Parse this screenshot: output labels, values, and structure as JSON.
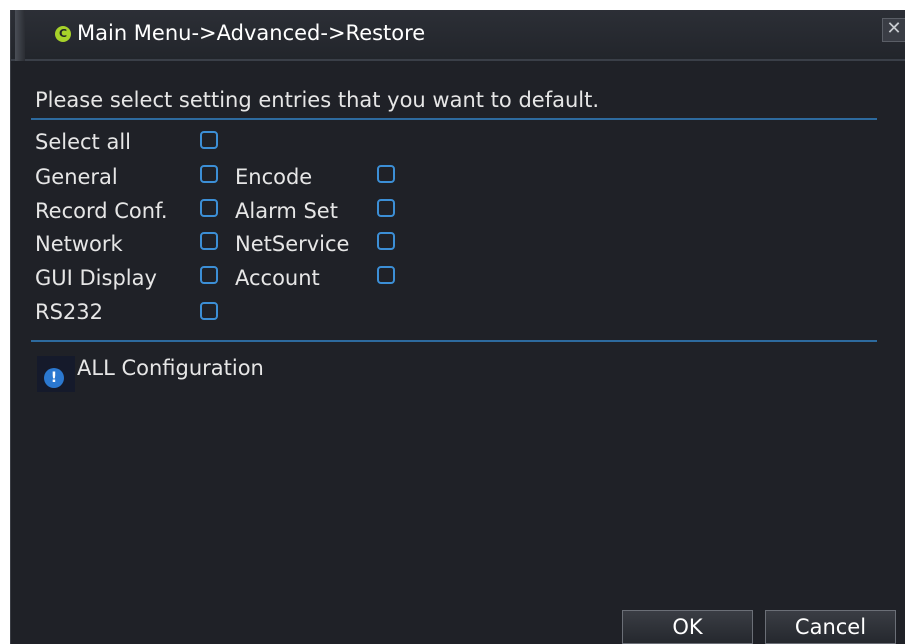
{
  "window": {
    "title": "Main Menu->Advanced->Restore",
    "logo_glyph": "C",
    "close_glyph": "✕"
  },
  "prompt": "Please select setting entries that you want to default.",
  "select_all": {
    "label": "Select all",
    "checked": false
  },
  "entries": [
    {
      "label": "General",
      "checked": false
    },
    {
      "label": "Encode",
      "checked": false
    },
    {
      "label": "Record Conf.",
      "checked": false
    },
    {
      "label": "Alarm Set",
      "checked": false
    },
    {
      "label": "Network",
      "checked": false
    },
    {
      "label": "NetService",
      "checked": false
    },
    {
      "label": "GUI Display",
      "checked": false
    },
    {
      "label": "Account",
      "checked": false
    },
    {
      "label": "RS232",
      "checked": false
    }
  ],
  "info": {
    "icon": "info-icon",
    "glyph": "!",
    "text": "ALL Configuration"
  },
  "buttons": {
    "ok": "OK",
    "cancel": "Cancel"
  },
  "colors": {
    "background": "#1f2127",
    "accent": "#3c8fd6",
    "logo": "#a7d22a",
    "text": "#e6e6e6"
  }
}
